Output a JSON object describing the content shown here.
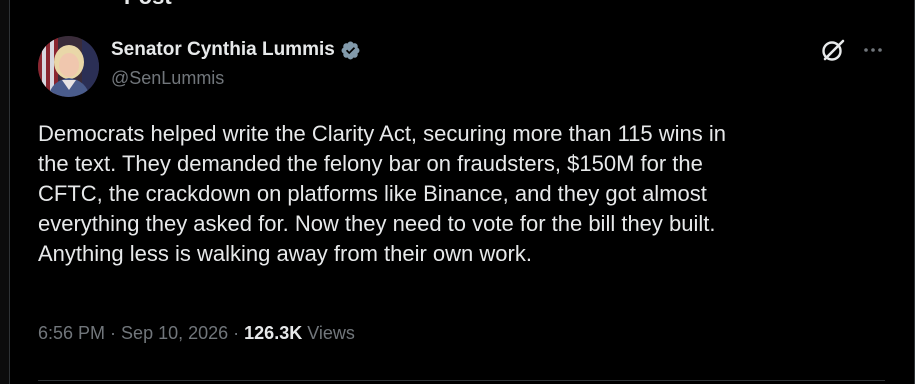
{
  "header": {
    "title": "Post"
  },
  "author": {
    "display_name": "Senator Cynthia Lummis",
    "handle": "@SenLummis",
    "verified_icon": "verified-badge-icon",
    "verified_color": "#829aab"
  },
  "tweet": {
    "lines": [
      "Democrats helped write the Clarity Act, securing more than 115 wins in",
      "the text. They demanded the felony bar on fraudsters, $150M for the",
      "CFTC, the crackdown on platforms like Binance, and they got almost",
      "everything they asked for. Now they need to vote for the bill they built.",
      "Anything less is walking away from their own work."
    ]
  },
  "meta": {
    "time": "6:56 PM",
    "separator": "·",
    "date": "Sep 10, 2026",
    "views_count": "126.3K",
    "views_label": "Views"
  },
  "icons": {
    "grok": "grok-icon",
    "more": "more-options-icon"
  },
  "colors": {
    "background": "#000000",
    "text": "#e7e9ea",
    "secondary": "#71767b",
    "border": "#2f3336"
  }
}
